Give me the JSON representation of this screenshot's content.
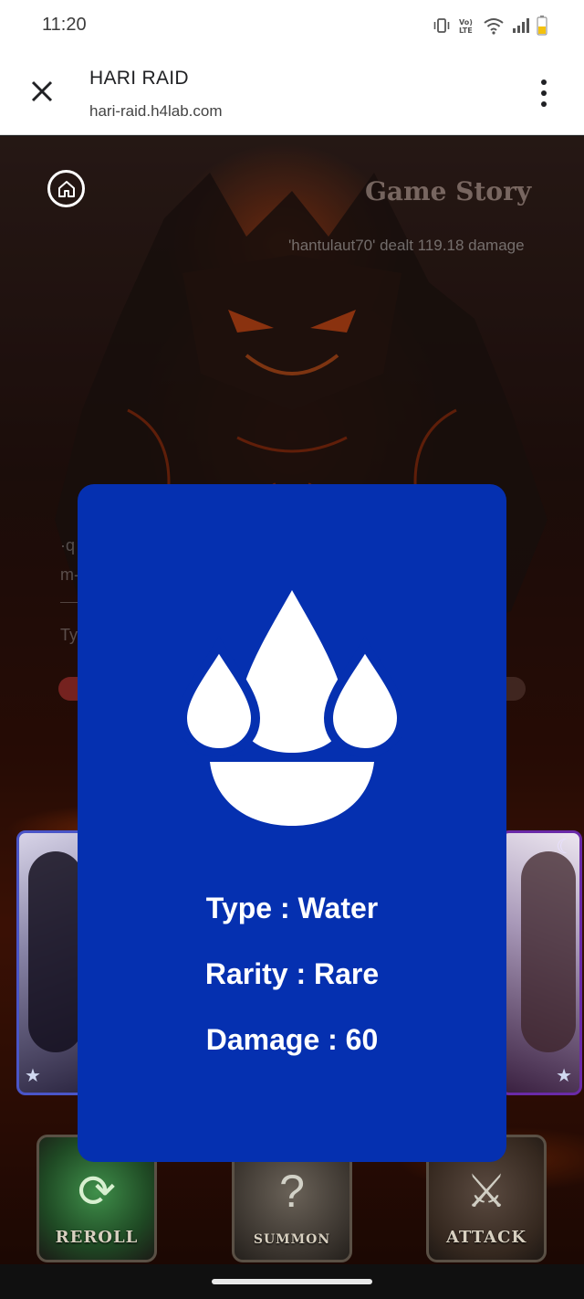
{
  "status_bar": {
    "time": "11:20",
    "icons": [
      "vibrate-icon",
      "volte-icon",
      "wifi-icon",
      "signal-icon",
      "battery-icon"
    ],
    "battery_color": "#f4c20d"
  },
  "browser": {
    "title": "HARI RAID",
    "url": "hari-raid.h4lab.com"
  },
  "game": {
    "header_title": "Game Story",
    "log_line": "'hantulaut70' dealt 119.18 damage",
    "obscured_fragments": [
      "·q",
      "m-",
      "Ty"
    ]
  },
  "characters": [
    {
      "name": "",
      "star": "★",
      "frame_color": "#4a55c8"
    },
    {
      "name": "",
      "star": "★",
      "frame_color": "#6a2aa8"
    }
  ],
  "actions": {
    "reroll": "REROLL",
    "summon": "SUMMON",
    "attack": "ATTACK"
  },
  "card_modal": {
    "background": "#0530b0",
    "emblem": "water-drops-icon",
    "type_line": "Type : Water",
    "rarity_line": "Rarity : Rare",
    "damage_line": "Damage : 60"
  }
}
